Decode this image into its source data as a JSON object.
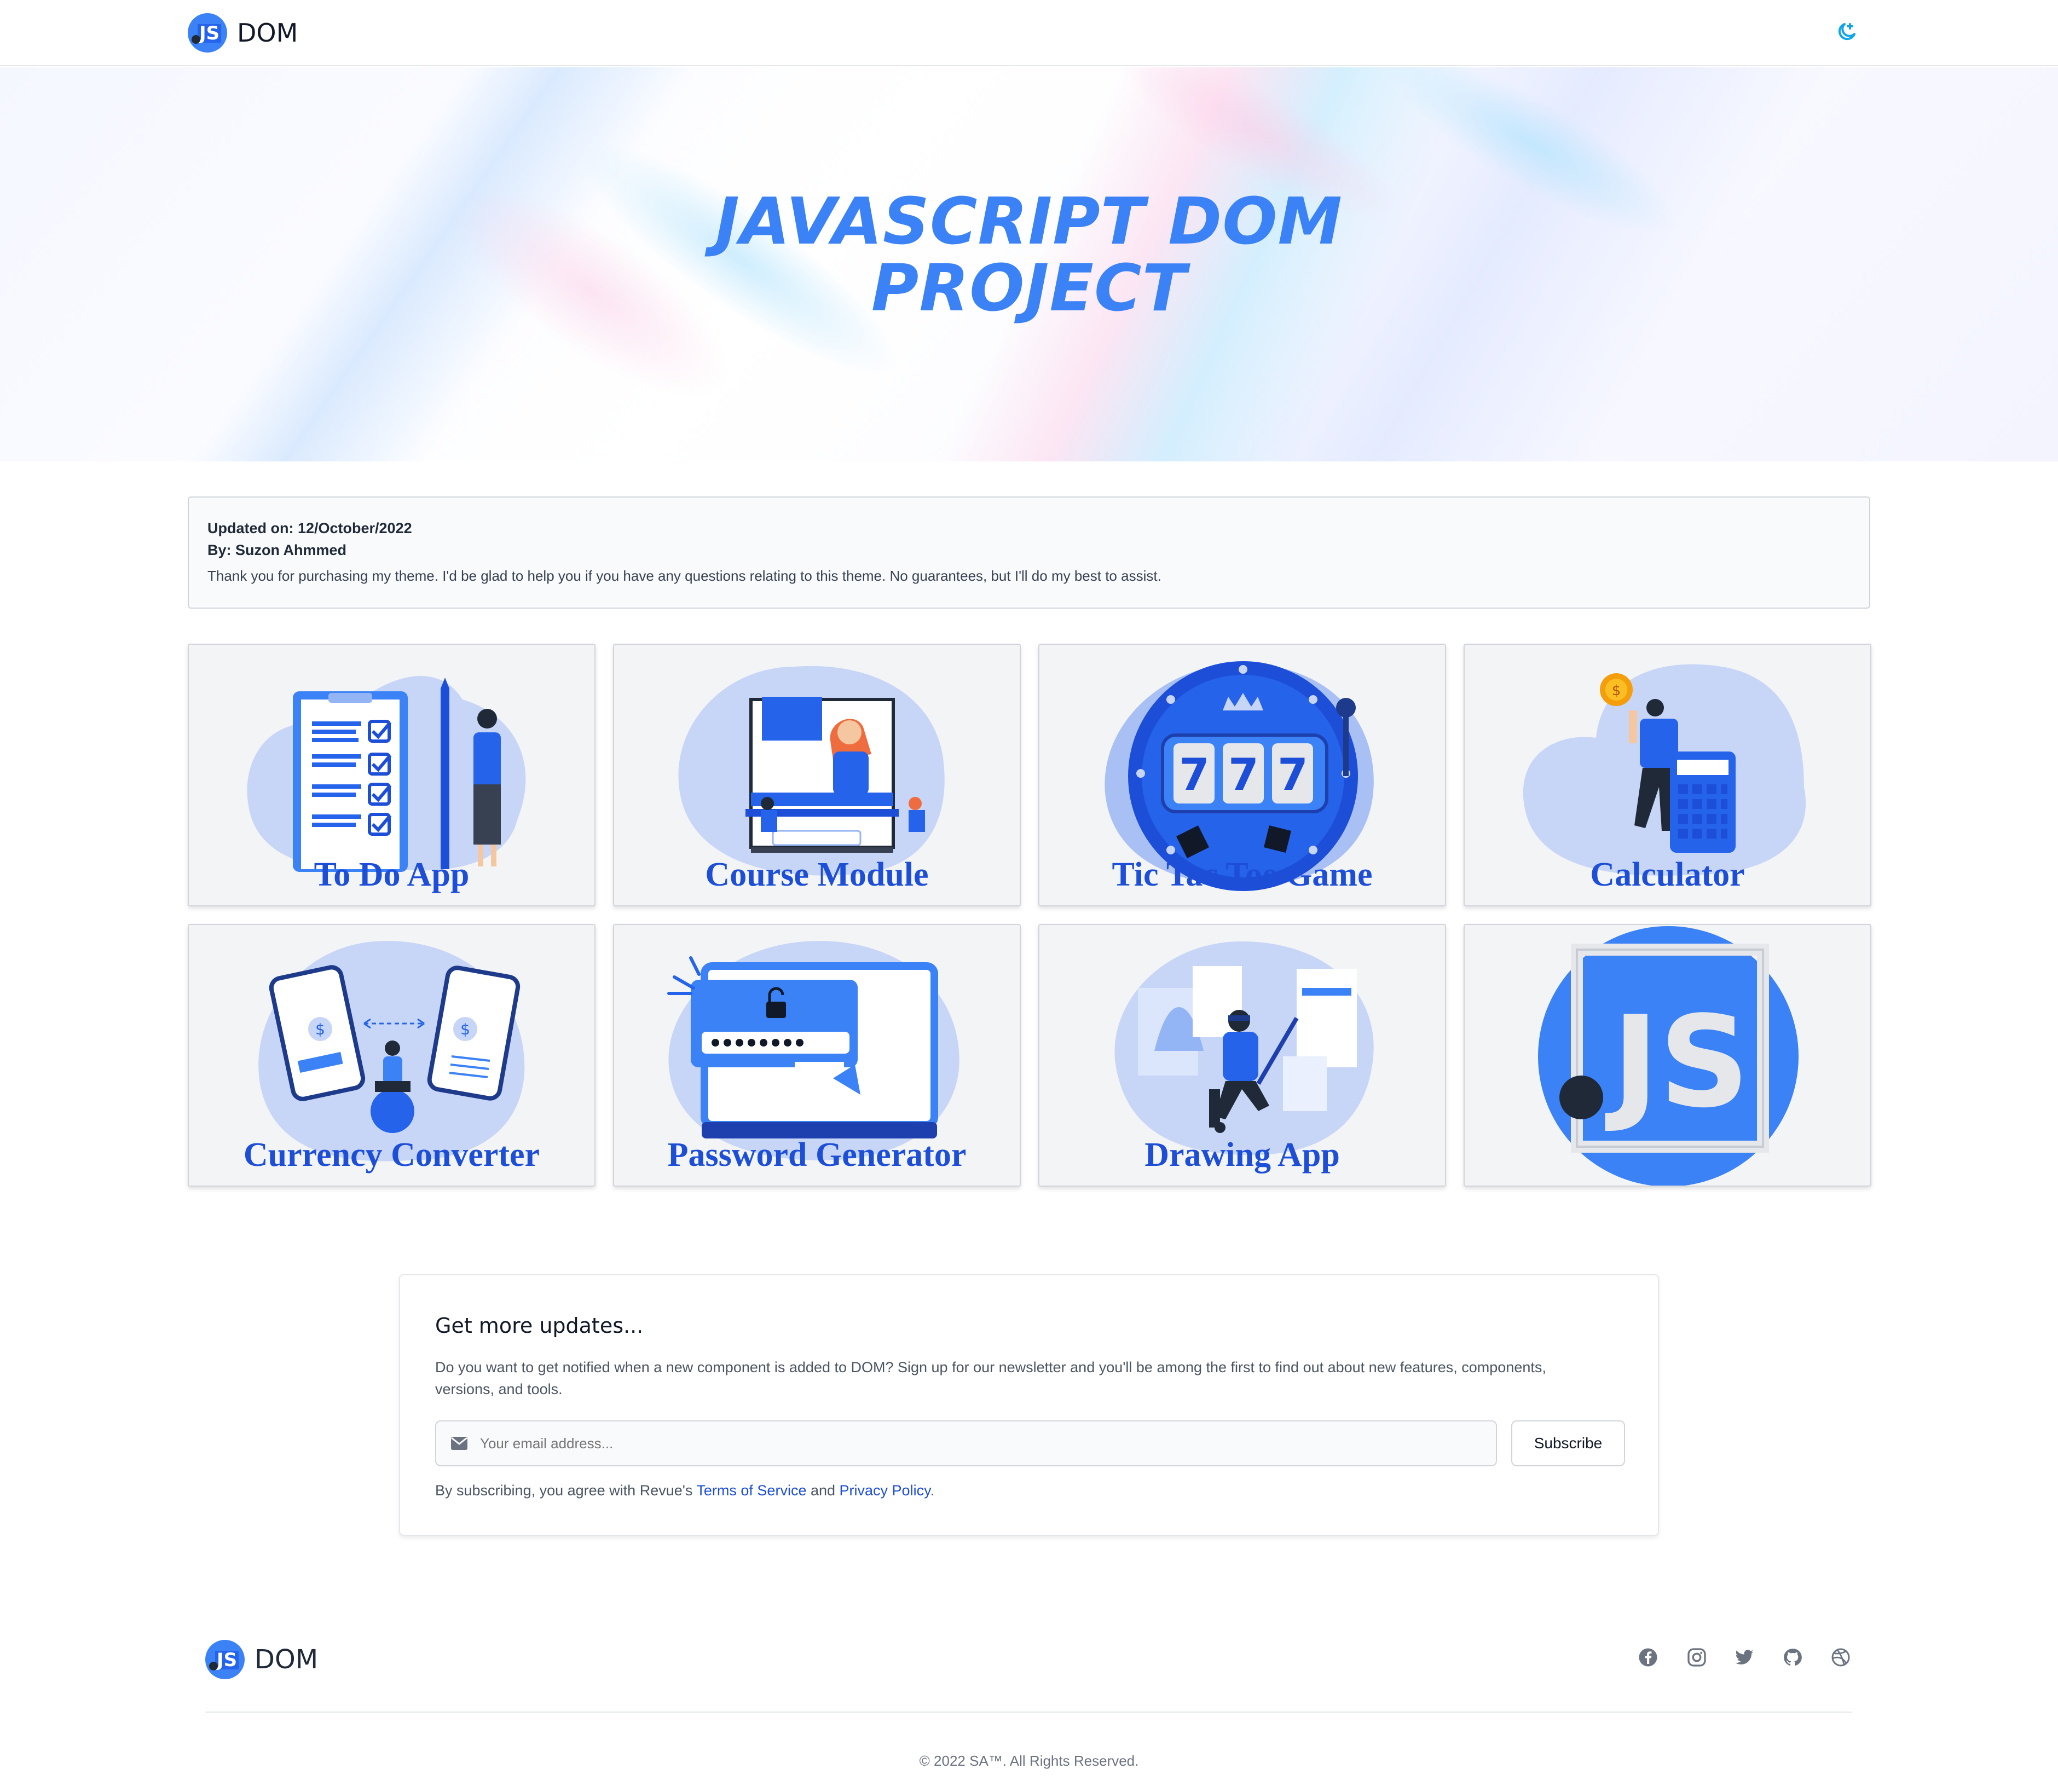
{
  "header": {
    "brand_logo_text": "JS",
    "brand_name": "DOM",
    "theme_toggle_icon": "moon-star-icon"
  },
  "hero": {
    "title_line1": "JAVASCRIPT DOM",
    "title_line2": "PROJECT"
  },
  "info": {
    "updated": "Updated on: 12/October/2022",
    "author": "By: Suzon Ahmmed",
    "message": "Thank you for purchasing my theme. I'd be glad to help you if you have any questions relating to this theme. No guarantees, but I'll do my best to assist."
  },
  "projects": [
    {
      "label": "To Do App",
      "icon": "todo-checklist-illustration"
    },
    {
      "label": "Course Module",
      "icon": "online-course-illustration"
    },
    {
      "label": "Tic Tac Toe Game",
      "icon": "slot-machine-777-illustration"
    },
    {
      "label": "Calculator",
      "icon": "calculator-illustration"
    },
    {
      "label": "Currency Converter",
      "icon": "currency-exchange-illustration"
    },
    {
      "label": "Password Generator",
      "icon": "password-laptop-illustration"
    },
    {
      "label": "Drawing App",
      "icon": "drawing-artist-illustration"
    },
    {
      "label": "",
      "icon": "js-logo-illustration"
    }
  ],
  "newsletter": {
    "title": "Get more updates...",
    "description": "Do you want to get notified when a new component is added to DOM? Sign up for our newsletter and you'll be among the first to find out about new features, components, versions, and tools.",
    "email_placeholder": "Your email address...",
    "subscribe_label": "Subscribe",
    "terms_prefix": "By subscribing, you agree with Revue's ",
    "terms_link": "Terms of Service",
    "terms_and": " and ",
    "privacy_link": "Privacy Policy",
    "terms_suffix": "."
  },
  "footer": {
    "brand_logo_text": "JS",
    "brand_name": "DOM",
    "social_icons": [
      "facebook-icon",
      "instagram-icon",
      "twitter-icon",
      "github-icon",
      "dribbble-icon"
    ],
    "copyright": "© 2022 SA™. All Rights Reserved."
  },
  "colors": {
    "accent": "#3b82f6",
    "accent_dark": "#1d4ed8",
    "card_bg": "#f3f4f6"
  }
}
